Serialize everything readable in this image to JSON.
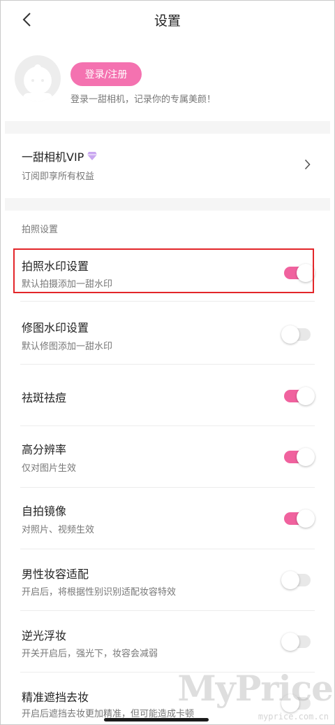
{
  "header": {
    "title": "设置"
  },
  "profile": {
    "login_label": "登录/注册",
    "subtitle": "登录一甜相机，记录你的专属美颜！"
  },
  "vip": {
    "title": "一甜相机VIP",
    "subtitle": "订阅即享所有权益"
  },
  "section": {
    "label": "拍照设置"
  },
  "settings": [
    {
      "title": "拍照水印设置",
      "subtitle": "默认拍摄添加一甜水印",
      "enabled": true
    },
    {
      "title": "修图水印设置",
      "subtitle": "默认修图添加一甜水印",
      "enabled": false
    },
    {
      "title": "祛斑祛痘",
      "subtitle": "",
      "enabled": true
    },
    {
      "title": "高分辨率",
      "subtitle": "仅对图片生效",
      "enabled": true
    },
    {
      "title": "自拍镜像",
      "subtitle": "对照片、视频生效",
      "enabled": true
    },
    {
      "title": "男性妆容适配",
      "subtitle": "开启后，将根据性别识别适配妆容特效",
      "enabled": false
    },
    {
      "title": "逆光浮妆",
      "subtitle": "开关开启后，强光下，妆容会减弱",
      "enabled": false
    },
    {
      "title": "精准遮挡去妆",
      "subtitle": "开启后遮挡去妆更加精准，但可能造成卡顿",
      "enabled": false
    }
  ],
  "watermark": {
    "text": "MyPrice",
    "url": "myprice.com.cn"
  },
  "colors": {
    "accent": "#f0629e",
    "highlight": "#e3262a"
  },
  "icons": {
    "back": "chevron-left-icon",
    "vip_badge": "diamond-icon",
    "vip_arrow": "chevron-right-icon"
  }
}
